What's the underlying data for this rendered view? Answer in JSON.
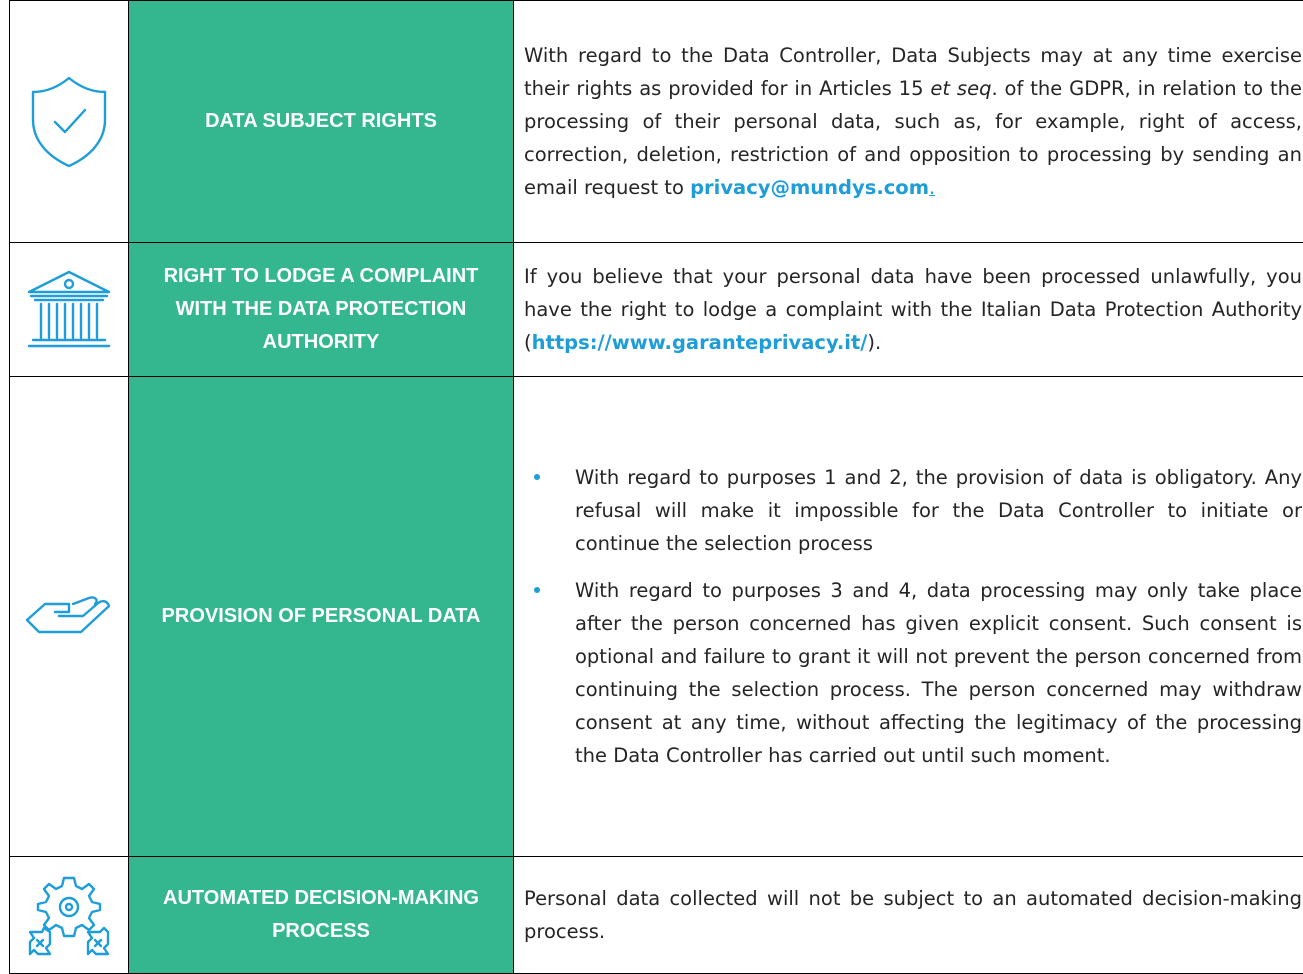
{
  "colors": {
    "accent_blue": "#1e9dd8",
    "label_green": "#34b78e"
  },
  "rows": [
    {
      "icon": "shield-check-icon",
      "label": "DATA SUBJECT RIGHTS",
      "text_before_link": "With regard to the Data Controller, Data Subjects may at any time exercise their rights as provided for in Articles 15 ",
      "italic": "et seq",
      "text_after_italic": ". of the GDPR, in relation to the processing of their personal data, such as, for example, right of access, correction, deletion, restriction of and opposition to processing by sending an email request to ",
      "link": "privacy@mundys.com",
      "trailing": "."
    },
    {
      "icon": "courthouse-icon",
      "label": "RIGHT TO LODGE A COMPLAINT WITH THE DATA PROTECTION AUTHORITY",
      "text": "If you believe that your personal data have been processed unlawfully, you have the right to lodge a complaint with the Italian Data Protection Authority (",
      "link": "https://www.garanteprivacy.it/",
      "trailing": ")."
    },
    {
      "icon": "hand-icon",
      "label": "PROVISION OF PERSONAL DATA",
      "bullets": [
        "With regard to purposes 1 and 2, the provision of data is obligatory. Any refusal will make it impossible for the Data Controller to initiate or continue the selection process",
        "With regard to purposes 3 and 4,  data processing may only take place after the person concerned has given explicit consent. Such consent is optional and failure to grant it will not prevent the person concerned from continuing the selection process. The person concerned may withdraw consent at any time, without affecting the legitimacy of the processing the Data Controller has carried out until such moment."
      ]
    },
    {
      "icon": "gears-icon",
      "label": "AUTOMATED DECISION-MAKING PROCESS",
      "text": "Personal data collected will not be subject to an automated decision-making process."
    }
  ]
}
